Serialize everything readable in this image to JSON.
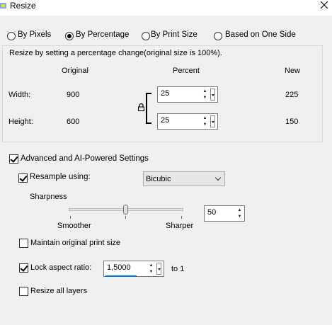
{
  "window": {
    "title": "Resize"
  },
  "modes": [
    {
      "label": "By Pixels",
      "selected": false
    },
    {
      "label": "By Percentage",
      "selected": true
    },
    {
      "label": "By Print Size",
      "selected": false
    },
    {
      "label": "Based on One Side",
      "selected": false
    }
  ],
  "group": {
    "caption": "Resize by setting a percentage change(original size is 100%).",
    "headers": {
      "original": "Original",
      "percent": "Percent",
      "new": "New"
    },
    "width": {
      "label": "Width:",
      "original": "900",
      "percent": "25",
      "new": "225"
    },
    "height": {
      "label": "Height:",
      "original": "600",
      "percent": "25",
      "new": "150"
    }
  },
  "advanced": {
    "label": "Advanced and AI-Powered Settings",
    "checked": true,
    "resample": {
      "label": "Resample using:",
      "checked": true,
      "method": "Bicubic"
    },
    "sharpness": {
      "label": "Sharpness",
      "left": "Smoother",
      "right": "Sharper",
      "value": "50",
      "level": 0.5
    },
    "maintain_print": {
      "label": "Maintain original print size",
      "checked": false
    },
    "lock_aspect": {
      "label": "Lock aspect ratio:",
      "checked": true,
      "value": "1,5000",
      "suffix": "to 1"
    },
    "resize_layers": {
      "label": "Resize all layers",
      "checked": false
    }
  },
  "colors": {
    "accent": "#0078d7",
    "slider_track": "#e7e7e7"
  }
}
